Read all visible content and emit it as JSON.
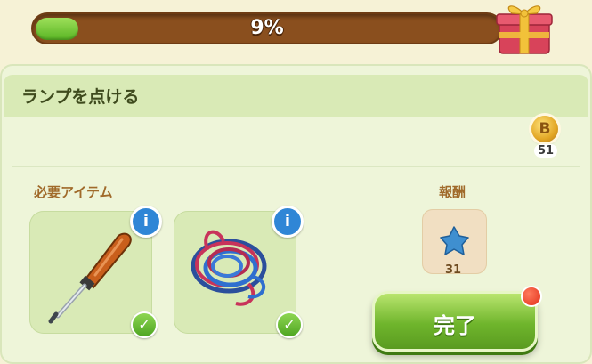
{
  "progress": {
    "label": "9%",
    "value": 0.09
  },
  "quest": {
    "title": "ランプを点ける",
    "coin": {
      "label": "B",
      "count": "51"
    }
  },
  "required": {
    "label": "必要アイテム",
    "items": [
      {
        "icon": "screwdriver-icon",
        "info": "i",
        "check": "✓"
      },
      {
        "icon": "wire-bundle-icon",
        "info": "i",
        "check": "✓"
      }
    ]
  },
  "reward": {
    "label": "報酬",
    "icon": "blue-star-icon",
    "count": "31"
  },
  "complete_button": {
    "label": "完了"
  },
  "colors": {
    "progress_fill": "#58b423",
    "progress_track": "#8a4f1e",
    "panel": "#eef5d9",
    "button": "#6fb52c",
    "info": "#2f86d6",
    "notification": "#e2301a"
  }
}
